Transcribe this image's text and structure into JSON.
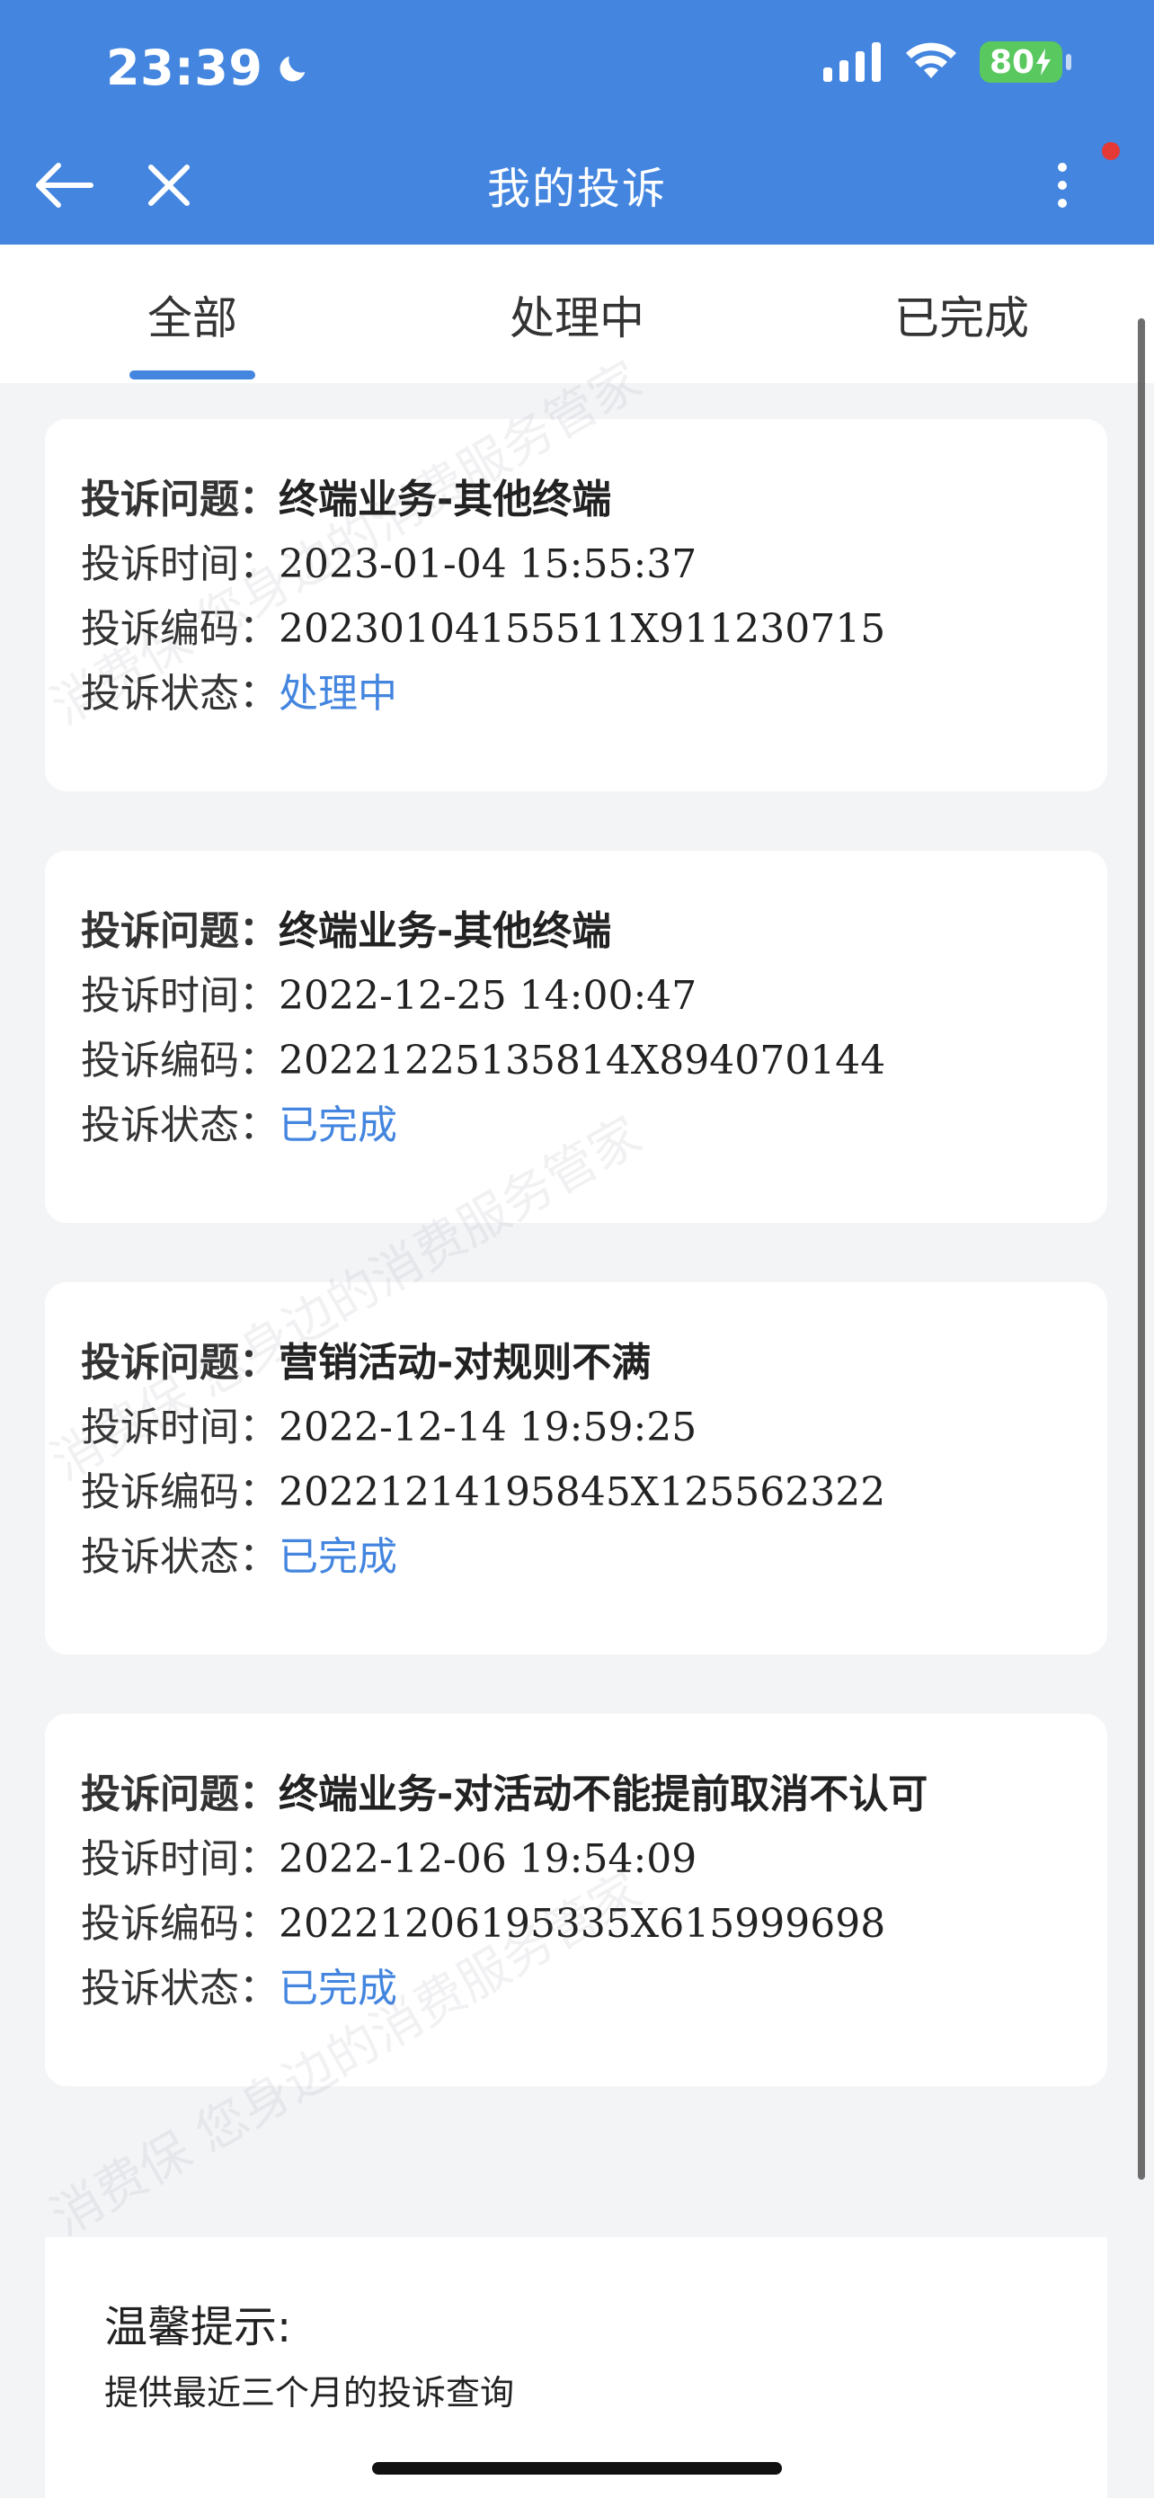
{
  "status_bar": {
    "time": "23:39",
    "battery": "80"
  },
  "header": {
    "title": "我的投诉"
  },
  "tabs": [
    {
      "label": "全部"
    },
    {
      "label": "处理中"
    },
    {
      "label": "已完成"
    }
  ],
  "labels": {
    "issue": "投诉问题：",
    "time": "投诉时间：",
    "code": "投诉编码：",
    "status": "投诉状态："
  },
  "complaints": [
    {
      "issue": "终端业务-其他终端",
      "time": "2023-01-04 15:55:37",
      "code": "20230104155511X911230715",
      "status": "处理中"
    },
    {
      "issue": "终端业务-其他终端",
      "time": "2022-12-25 14:00:47",
      "code": "20221225135814X894070144",
      "status": "已完成"
    },
    {
      "issue": "营销活动-对规则不满",
      "time": "2022-12-14 19:59:25",
      "code": "20221214195845X125562322",
      "status": "已完成"
    },
    {
      "issue": "终端业务-对活动不能提前取消不认可",
      "time": "2022-12-06 19:54:09",
      "code": "20221206195335X615999698",
      "status": "已完成"
    }
  ],
  "tip": {
    "title": "温馨提示:",
    "text": "提供最近三个月的投诉查询"
  },
  "watermark": {
    "text_a": "消费保 您身边的消费服务管家"
  },
  "colors": {
    "accent": "#4385df",
    "battery": "#59c85f"
  }
}
